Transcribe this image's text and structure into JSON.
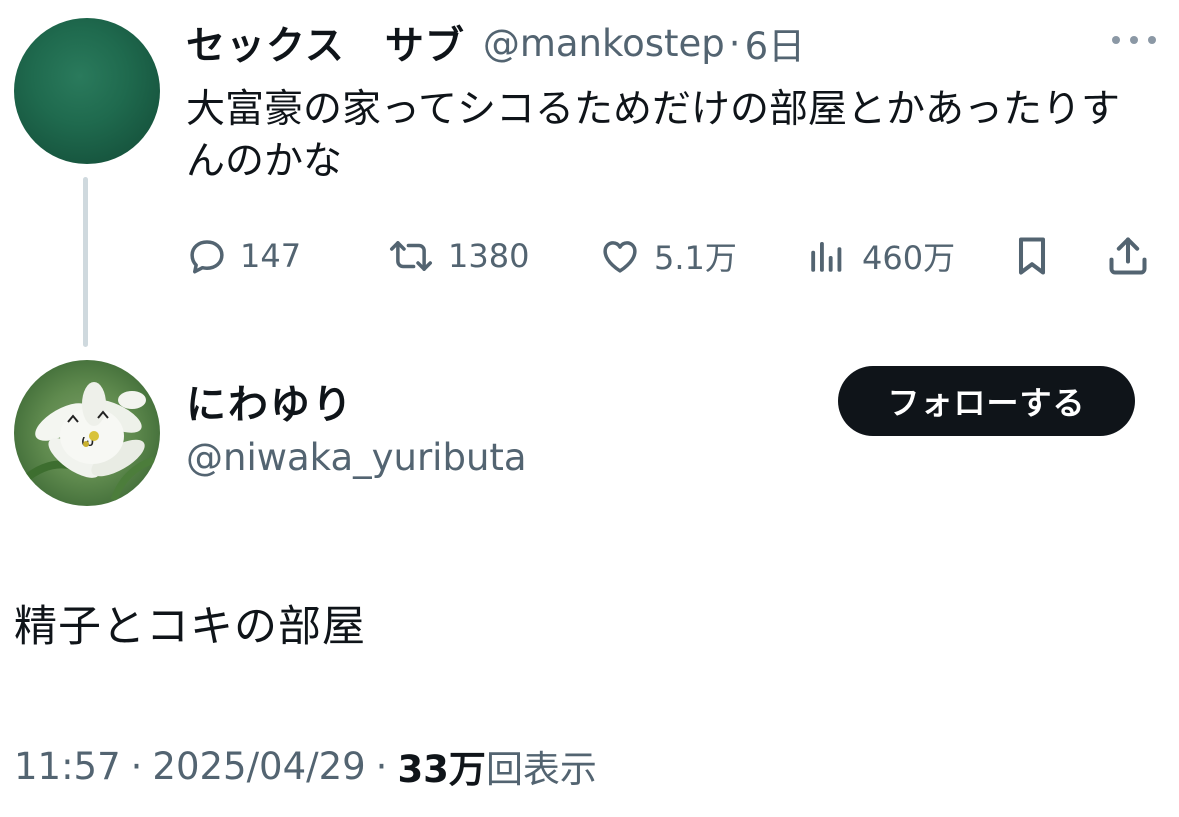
{
  "parent_tweet": {
    "display_name": "セックス　サブ",
    "handle": "@mankostep",
    "separator": "·",
    "time": "6日",
    "text": "大富豪の家ってシコるためだけの部屋とかあったりすんのかな",
    "avatar_color": "#1f6a4e",
    "actions": {
      "replies": "147",
      "retweets": "1380",
      "likes": "5.1万",
      "views": "460万"
    }
  },
  "reply_tweet": {
    "display_name": "にわゆり",
    "handle": "@niwaka_yuributa",
    "follow_label": "フォローする",
    "text": "精子とコキの部屋",
    "time": "11:57",
    "separator": "·",
    "date": "2025/04/29",
    "views_count": "33万",
    "views_suffix": "回表示"
  },
  "icons": {
    "more": "more-horizontal-icon",
    "reply": "speech-bubble-icon",
    "retweet": "retweet-arrows-icon",
    "like": "heart-icon",
    "views": "bar-chart-icon",
    "bookmark": "bookmark-icon",
    "share": "share-upload-icon"
  },
  "colors": {
    "primary_text": "#0f1419",
    "secondary_text": "#536471",
    "thread_line": "#cfd9de",
    "follow_button_bg": "#0f1419",
    "follow_button_text": "#ffffff"
  }
}
